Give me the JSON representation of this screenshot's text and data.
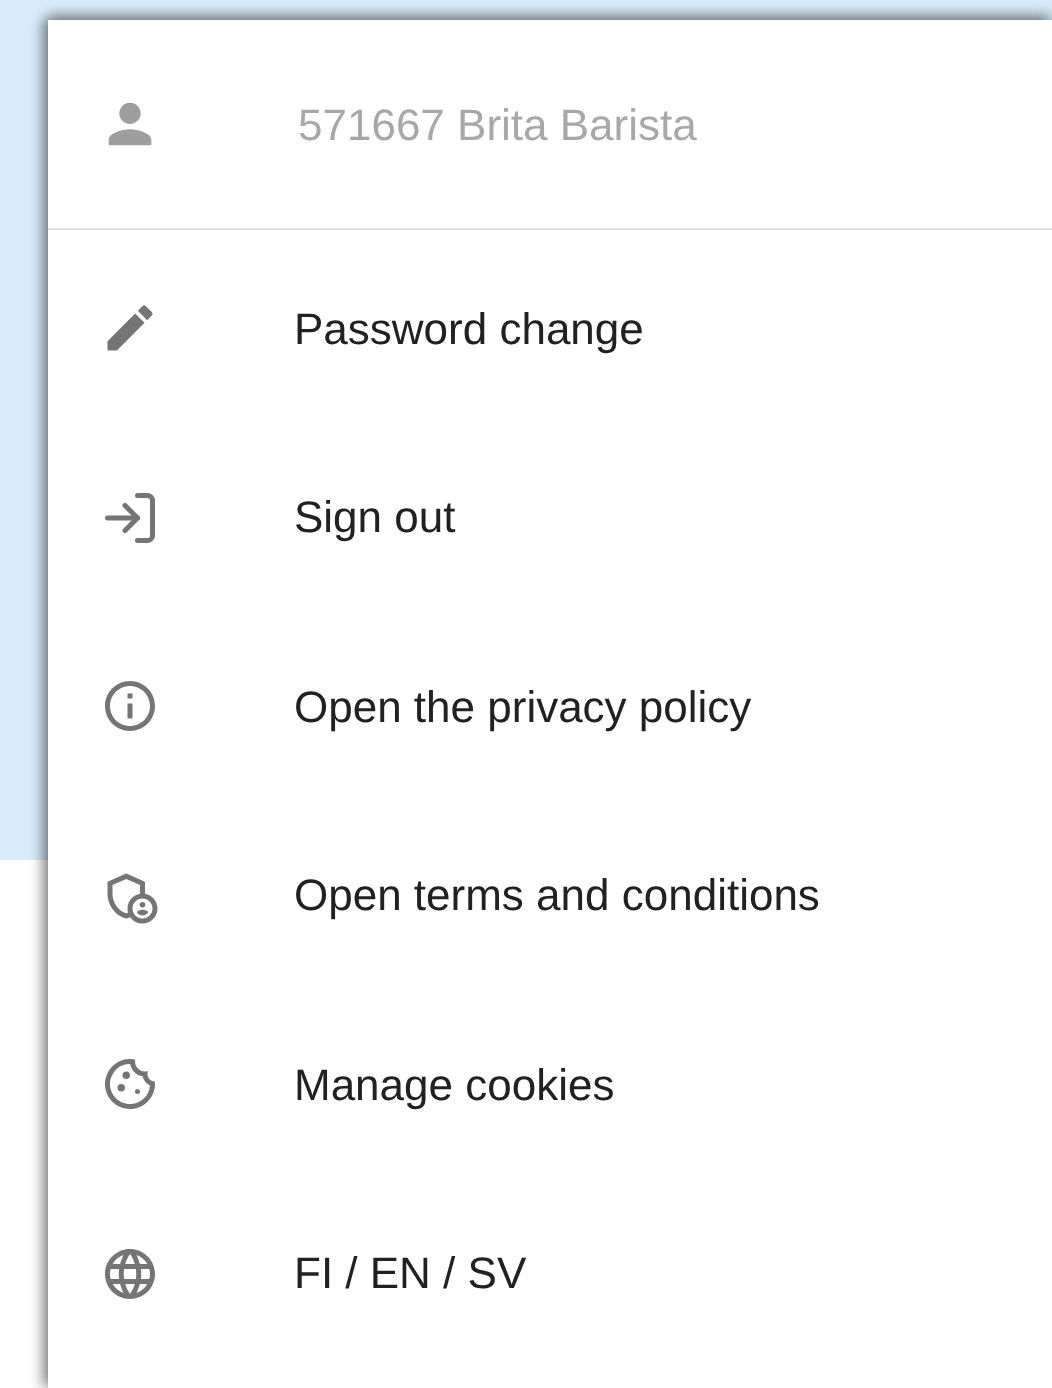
{
  "menu": {
    "user": {
      "label": "571667 Brita Barista",
      "disabled": true
    },
    "items": [
      {
        "kind": "edit",
        "label": "Password change"
      },
      {
        "kind": "signout",
        "label": "Sign out"
      },
      {
        "kind": "info",
        "label": "Open the privacy policy"
      },
      {
        "kind": "terms",
        "label": "Open terms and conditions"
      },
      {
        "kind": "cookie",
        "label": "Manage cookies"
      },
      {
        "kind": "language",
        "label": "FI / EN / SV"
      }
    ]
  }
}
